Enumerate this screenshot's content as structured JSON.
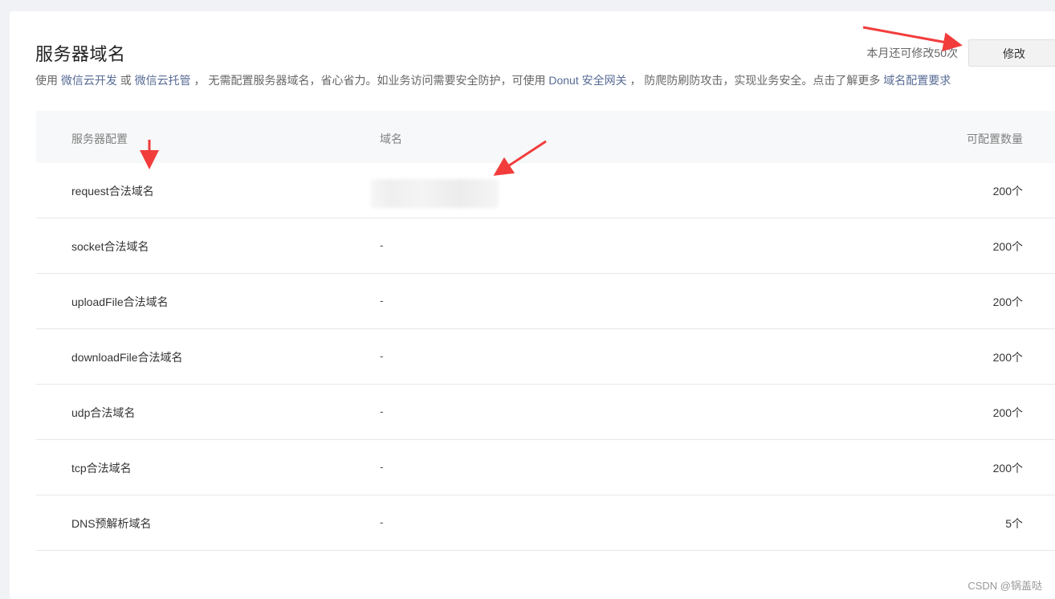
{
  "header": {
    "title": "服务器域名",
    "remaining": "本月还可修改50次",
    "modify_button": "修改"
  },
  "description": {
    "p1": "使用 ",
    "link1": "微信云开发",
    "p2": " 或 ",
    "link2": "微信云托管",
    "p3": " ， 无需配置服务器域名，省心省力。如业务访问需要安全防护，可使用 ",
    "link3": "Donut 安全网关",
    "p4": " ， 防爬防刷防攻击，实现业务安全。点击了解更多 ",
    "link4": "域名配置要求"
  },
  "table": {
    "headers": [
      "服务器配置",
      "域名",
      "可配置数量"
    ],
    "rows": [
      {
        "config": "request合法域名",
        "domain": "",
        "count": "200个"
      },
      {
        "config": "socket合法域名",
        "domain": "-",
        "count": "200个"
      },
      {
        "config": "uploadFile合法域名",
        "domain": "-",
        "count": "200个"
      },
      {
        "config": "downloadFile合法域名",
        "domain": "-",
        "count": "200个"
      },
      {
        "config": "udp合法域名",
        "domain": "-",
        "count": "200个"
      },
      {
        "config": "tcp合法域名",
        "domain": "-",
        "count": "200个"
      },
      {
        "config": "DNS预解析域名",
        "domain": "-",
        "count": "5个"
      }
    ]
  },
  "watermark": "CSDN @锅盖哒",
  "colors": {
    "link": "#576b95",
    "annotation_arrow": "#f23c3c"
  }
}
